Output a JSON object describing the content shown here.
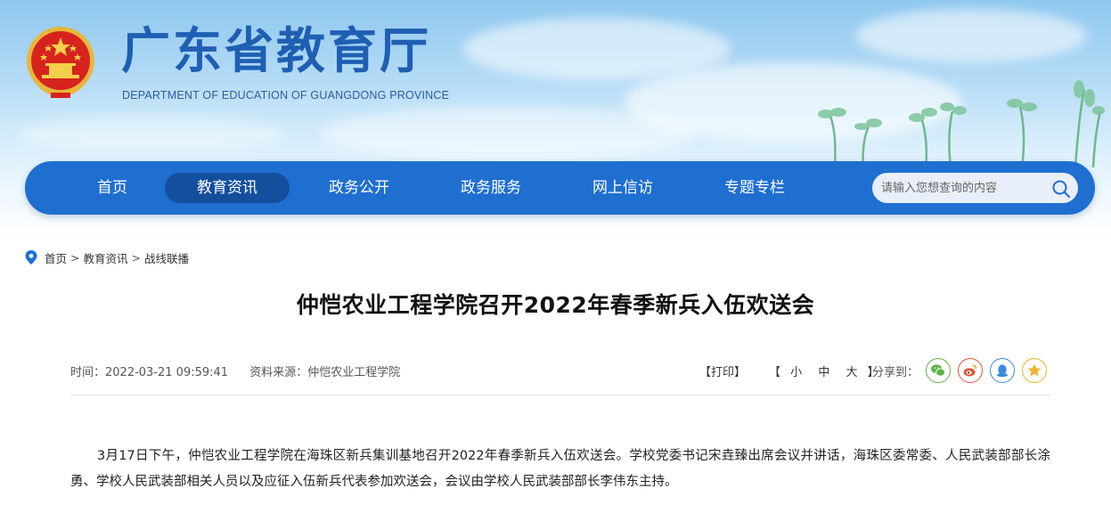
{
  "header": {
    "site_title": "广东省教育厅",
    "site_subtitle": "DEPARTMENT OF EDUCATION OF GUANGDONG PROVINCE",
    "emblem_icon": "national-emblem-icon"
  },
  "nav": {
    "items": [
      {
        "label": "首页"
      },
      {
        "label": "教育资讯",
        "active": true
      },
      {
        "label": "政务公开"
      },
      {
        "label": "政务服务"
      },
      {
        "label": "网上信访"
      },
      {
        "label": "专题专栏"
      }
    ],
    "search": {
      "placeholder": "请输入您想查询的内容",
      "icon": "search-icon"
    },
    "colors": {
      "bar": "#1f6fd0",
      "active": "#144f9e"
    }
  },
  "breadcrumb": {
    "icon": "location-pin-icon",
    "items": [
      "首页",
      "教育资讯",
      "战线联播"
    ],
    "separator": ">"
  },
  "article": {
    "title": "仲恺农业工程学院召开2022年春季新兵入伍欢送会",
    "time": "时间：2022-03-21 09:59:41",
    "source": "资料来源：仲恺农业工程学院",
    "print": "【打印】",
    "size_open": "【",
    "size_small": "小",
    "size_medium": "中",
    "size_large": "大",
    "size_close": "】",
    "share_label": "分享到：",
    "share_icons": [
      "wechat-icon",
      "weibo-icon",
      "qq-icon",
      "qzone-icon"
    ],
    "body": "3月17日下午，仲恺农业工程学院在海珠区新兵集训基地召开2022年春季新兵入伍欢送会。学校党委书记宋垚臻出席会议并讲话，海珠区委常委、人民武装部部长涂勇、学校人民武装部相关人员以及应征入伍新兵代表参加欢送会，会议由学校人民武装部部长李伟东主持。"
  }
}
